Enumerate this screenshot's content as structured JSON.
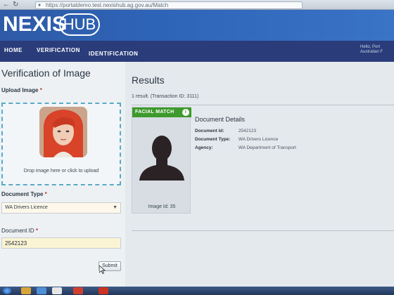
{
  "browser": {
    "url": "https://portaldemo.test.nexishub.ag.gov.au/Match"
  },
  "header": {
    "logo_primary": "NEXIS",
    "logo_secondary": "HUB",
    "user_line1": "Hello, Port",
    "user_line2": "Australian F"
  },
  "nav": {
    "items": [
      {
        "label": "HOME"
      },
      {
        "label": "VERIFICATION"
      },
      {
        "label": "IDENTIFICATION"
      }
    ]
  },
  "form": {
    "title": "Verification of Image",
    "upload_label": "Upload Image",
    "upload_hint": "Drop image here or click to upload",
    "document_type_label": "Document Type",
    "document_type_value": "WA Drivers Licence",
    "document_id_label": "Document ID",
    "document_id_value": "2542123",
    "submit_label": "Submit",
    "required_marker": "*"
  },
  "results": {
    "title": "Results",
    "summary": "1 result. (Transaction ID: 3111)",
    "match_badge": "FACIAL MATCH",
    "image_id": "Image Id: 35",
    "details_title": "Document Details",
    "details": [
      {
        "key": "Document Id:",
        "value": "2542123"
      },
      {
        "key": "Document Type:",
        "value": "WA Drivers Licence"
      },
      {
        "key": "Agency:",
        "value": "WA Department of Transport"
      }
    ]
  },
  "icons": {
    "info": "info-icon",
    "back": "back-arrow-icon",
    "reload": "reload-icon",
    "lock": "lock-icon",
    "avatar": "person-silhouette-icon",
    "cursor": "mouse-cursor-icon"
  },
  "colors": {
    "header_blue": "#2e64b8",
    "nav_navy": "#2a3c7a",
    "match_green": "#3e9a2c",
    "upload_border": "#5aa9c8",
    "required_red": "#c0392b"
  }
}
